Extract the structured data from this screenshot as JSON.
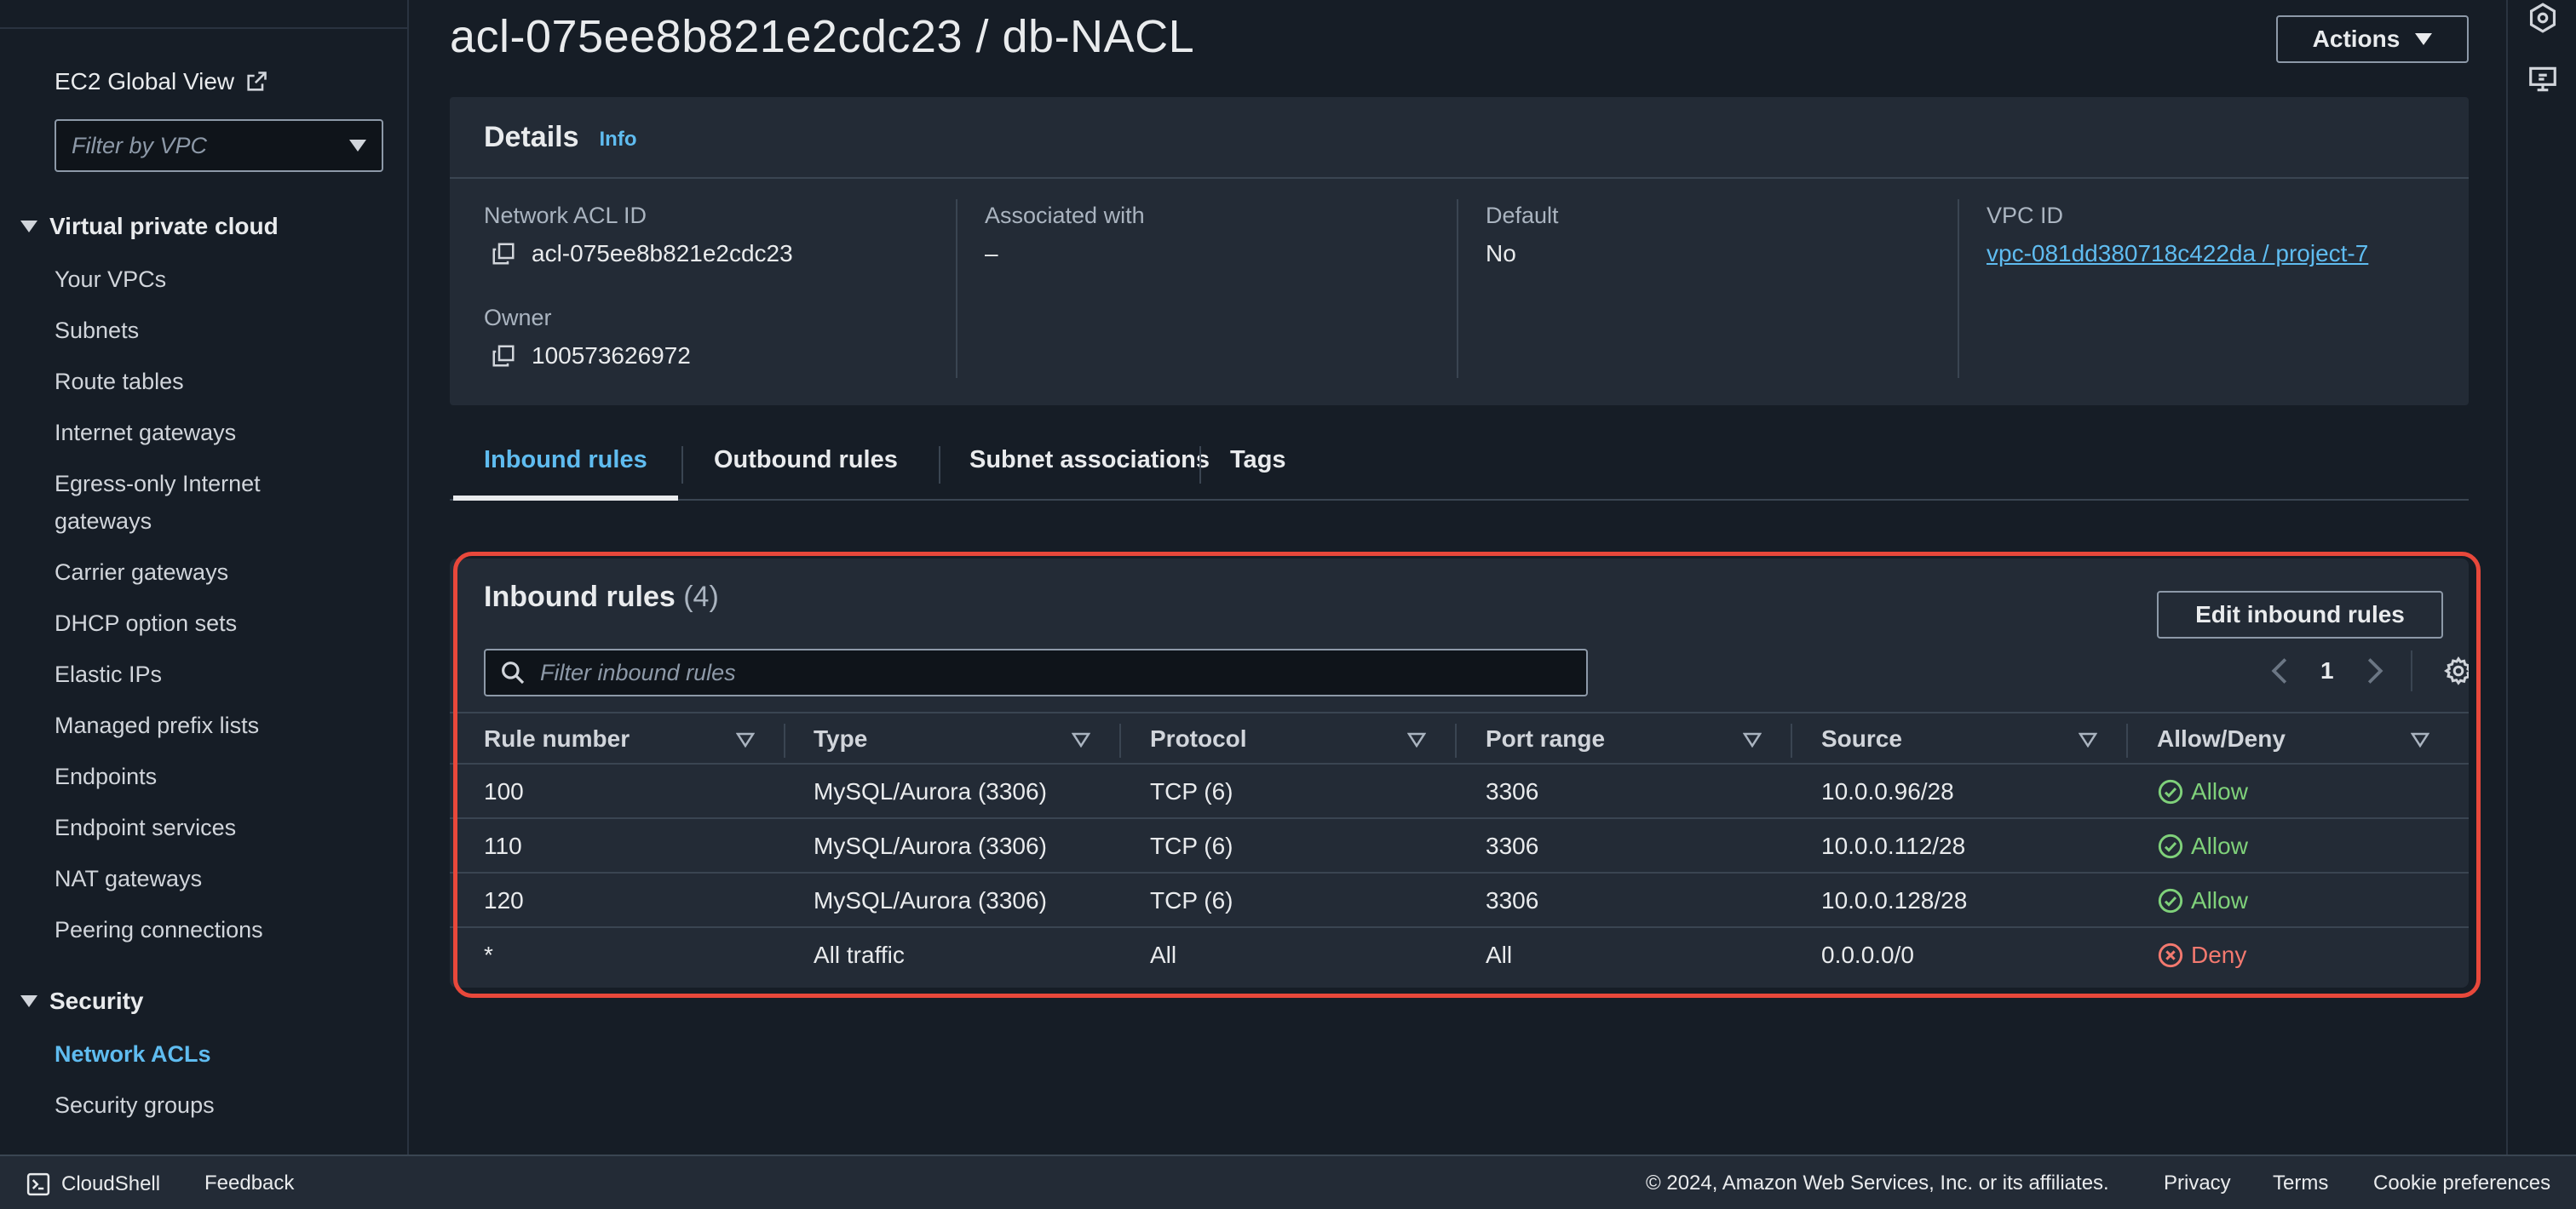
{
  "sidebar": {
    "global_view": "EC2 Global View",
    "vpc_filter_placeholder": "Filter by VPC",
    "section_vpc": "Virtual private cloud",
    "vpc_items": [
      "Your VPCs",
      "Subnets",
      "Route tables",
      "Internet gateways",
      "Egress-only Internet",
      "gateways",
      "Carrier gateways",
      "DHCP option sets",
      "Elastic IPs",
      "Managed prefix lists",
      "Endpoints",
      "Endpoint services",
      "NAT gateways",
      "Peering connections"
    ],
    "section_security": "Security",
    "security_items": [
      "Network ACLs",
      "Security groups"
    ]
  },
  "header": {
    "title": "acl-075ee8b821e2cdc23 / db-NACL",
    "actions_label": "Actions"
  },
  "details": {
    "heading": "Details",
    "info": "Info",
    "acl_id_label": "Network ACL ID",
    "acl_id_value": "acl-075ee8b821e2cdc23",
    "owner_label": "Owner",
    "owner_value": "100573626972",
    "associated_label": "Associated with",
    "associated_value": "–",
    "default_label": "Default",
    "default_value": "No",
    "vpc_label": "VPC ID",
    "vpc_value": "vpc-081dd380718c422da / project-7"
  },
  "tabs": [
    "Inbound rules",
    "Outbound rules",
    "Subnet associations",
    "Tags"
  ],
  "rules": {
    "title": "Inbound rules",
    "count": "(4)",
    "edit_label": "Edit inbound rules",
    "search_placeholder": "Filter inbound rules",
    "page": "1",
    "columns": [
      "Rule number",
      "Type",
      "Protocol",
      "Port range",
      "Source",
      "Allow/Deny"
    ],
    "rows": [
      [
        "100",
        "MySQL/Aurora (3306)",
        "TCP (6)",
        "3306",
        "10.0.0.96/28",
        "Allow"
      ],
      [
        "110",
        "MySQL/Aurora (3306)",
        "TCP (6)",
        "3306",
        "10.0.0.112/28",
        "Allow"
      ],
      [
        "120",
        "MySQL/Aurora (3306)",
        "TCP (6)",
        "3306",
        "10.0.0.128/28",
        "Allow"
      ],
      [
        "*",
        "All traffic",
        "All",
        "All",
        "0.0.0.0/0",
        "Deny"
      ]
    ]
  },
  "footer": {
    "cloudshell": "CloudShell",
    "feedback": "Feedback",
    "copyright": "© 2024, Amazon Web Services, Inc. or its affiliates.",
    "privacy": "Privacy",
    "terms": "Terms",
    "cookies": "Cookie preferences"
  },
  "colors": {
    "accent": "#5fbcf0",
    "allow": "#7fd17a",
    "deny": "#f3796f",
    "highlight": "#e8483b"
  }
}
